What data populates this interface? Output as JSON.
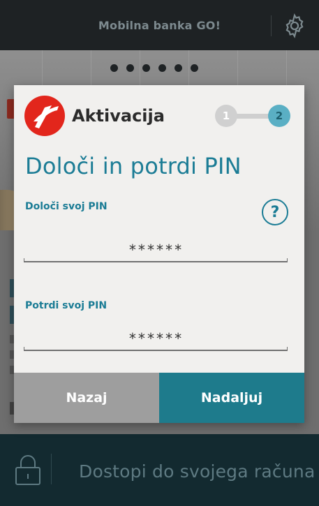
{
  "app": {
    "title": "Mobilna banka GO!",
    "settings_icon": "gear-icon"
  },
  "carousel": {
    "total": 6,
    "active": 1
  },
  "modal": {
    "title": "Aktivacija",
    "logo_icon": "unicredit-logo-icon",
    "steps": [
      "1",
      "2"
    ],
    "current_step": 2,
    "heading": "Določi in potrdi PIN",
    "help_icon": "help-icon",
    "help_label": "?",
    "fields": [
      {
        "label": "Določi svoj PIN",
        "value": "******"
      },
      {
        "label": "Potrdi svoj PIN",
        "value": "******"
      }
    ],
    "back_label": "Nazaj",
    "next_label": "Nadaljuj"
  },
  "bottom": {
    "text": "Dostopi do svojega računa",
    "lock_icon": "lock-icon"
  },
  "colors": {
    "accent": "#1b7c95",
    "next_button": "#1e7b8c",
    "back_button": "#9e9e9e",
    "brand_red": "#e2261c",
    "topbar": "#1e2224",
    "bottombar": "#132a30"
  }
}
